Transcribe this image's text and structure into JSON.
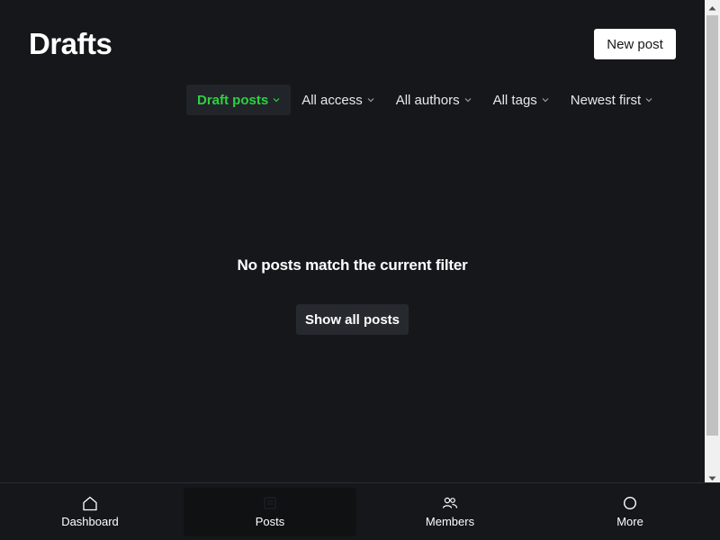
{
  "header": {
    "title": "Drafts",
    "new_post_label": "New post"
  },
  "filters": [
    {
      "label": "Draft posts",
      "active": true
    },
    {
      "label": "All access",
      "active": false
    },
    {
      "label": "All authors",
      "active": false
    },
    {
      "label": "All tags",
      "active": false
    },
    {
      "label": "Newest first",
      "active": false
    }
  ],
  "empty_state": {
    "message": "No posts match the current filter",
    "button_label": "Show all posts"
  },
  "bottom_nav": [
    {
      "label": "Dashboard",
      "icon": "home-icon",
      "active": false
    },
    {
      "label": "Posts",
      "icon": "posts-icon",
      "active": true
    },
    {
      "label": "Members",
      "icon": "members-icon",
      "active": false
    },
    {
      "label": "More",
      "icon": "circle-icon",
      "active": false
    }
  ],
  "colors": {
    "background": "#15171a",
    "accent_green": "#30cf43",
    "button_dark": "#26292e"
  }
}
